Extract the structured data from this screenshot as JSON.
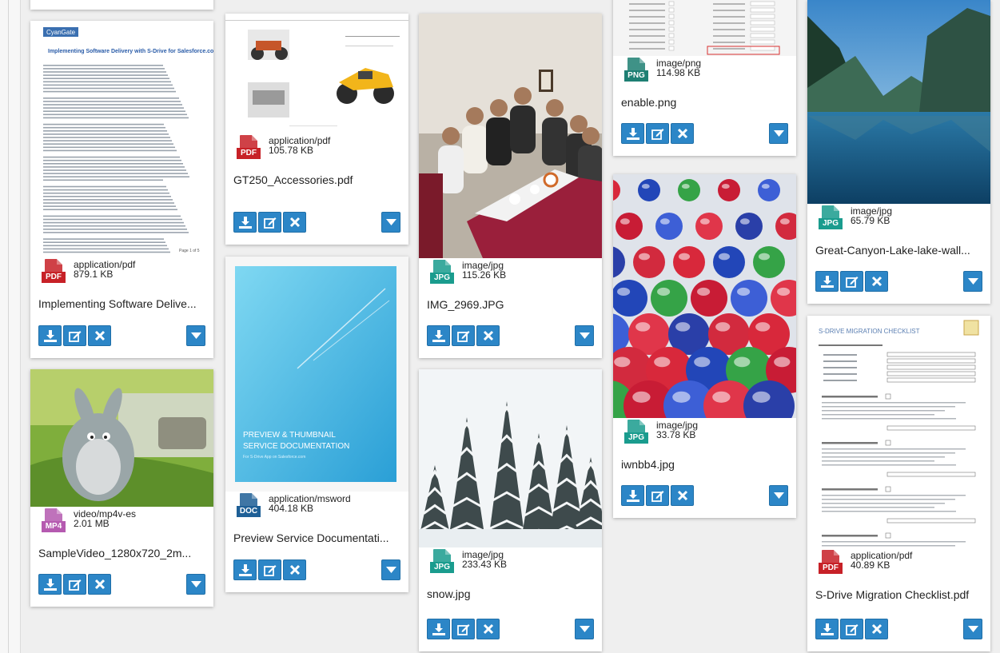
{
  "colors": {
    "accent": "#2c86c7",
    "pdf": "#c72127",
    "image": "#1a9c8e",
    "doc": "#1e5f96",
    "video": "#b55ab0",
    "png": "#1e7f73"
  },
  "files": [
    {
      "name": "Implementing Software Delive...",
      "mime": "application/pdf",
      "size": "879.1 KB",
      "icon": "pdf-file-icon",
      "tag": "PDF",
      "kind": "doc-implementing",
      "preview": {
        "brand": "CyanGate",
        "heading": "Implementing Software Delivery with S-Drive for Salesforce.com",
        "footer": "Page 1 of 5"
      }
    },
    {
      "name": "GT250_Accessories.pdf",
      "mime": "application/pdf",
      "size": "105.78 KB",
      "icon": "pdf-file-icon",
      "tag": "PDF",
      "kind": "doc-gt250"
    },
    {
      "name": "IMG_2969.JPG",
      "mime": "image/jpg",
      "size": "115.26 KB",
      "icon": "jpg-file-icon",
      "tag": "JPG",
      "kind": "photo-dinner"
    },
    {
      "name": "enable.png",
      "mime": "image/png",
      "size": "114.98 KB",
      "icon": "png-file-icon",
      "tag": "PNG",
      "kind": "screenshot-enable"
    },
    {
      "name": "Great-Canyon-Lake-lake-wall...",
      "mime": "image/jpg",
      "size": "65.79 KB",
      "icon": "jpg-file-icon",
      "tag": "JPG",
      "kind": "photo-lake"
    },
    {
      "name": "SampleVideo_1280x720_2m...",
      "mime": "video/mp4v-es",
      "size": "2.01 MB",
      "icon": "mp4-file-icon",
      "tag": "MP4",
      "kind": "video-bunny"
    },
    {
      "name": "Preview Service Documentati...",
      "mime": "application/msword",
      "size": "404.18 KB",
      "icon": "word-file-icon",
      "tag": "DOC",
      "kind": "doc-preview",
      "preview": {
        "title_line1": "PREVIEW & THUMBNAIL",
        "title_line2": "SERVICE DOCUMENTATION",
        "subtitle": "For S-Drive App on Salesforce.com"
      }
    },
    {
      "name": "snow.jpg",
      "mime": "image/jpg",
      "size": "233.43 KB",
      "icon": "jpg-file-icon",
      "tag": "JPG",
      "kind": "photo-snow"
    },
    {
      "name": "iwnbb4.jpg",
      "mime": "image/jpg",
      "size": "33.78 KB",
      "icon": "jpg-file-icon",
      "tag": "JPG",
      "kind": "photo-spheres"
    },
    {
      "name": "S-Drive Migration Checklist.pdf",
      "mime": "application/pdf",
      "size": "40.89 KB",
      "icon": "pdf-file-icon",
      "tag": "PDF",
      "kind": "doc-checklist",
      "preview": {
        "heading": "S-DRIVE MIGRATION CHECKLIST"
      }
    }
  ]
}
